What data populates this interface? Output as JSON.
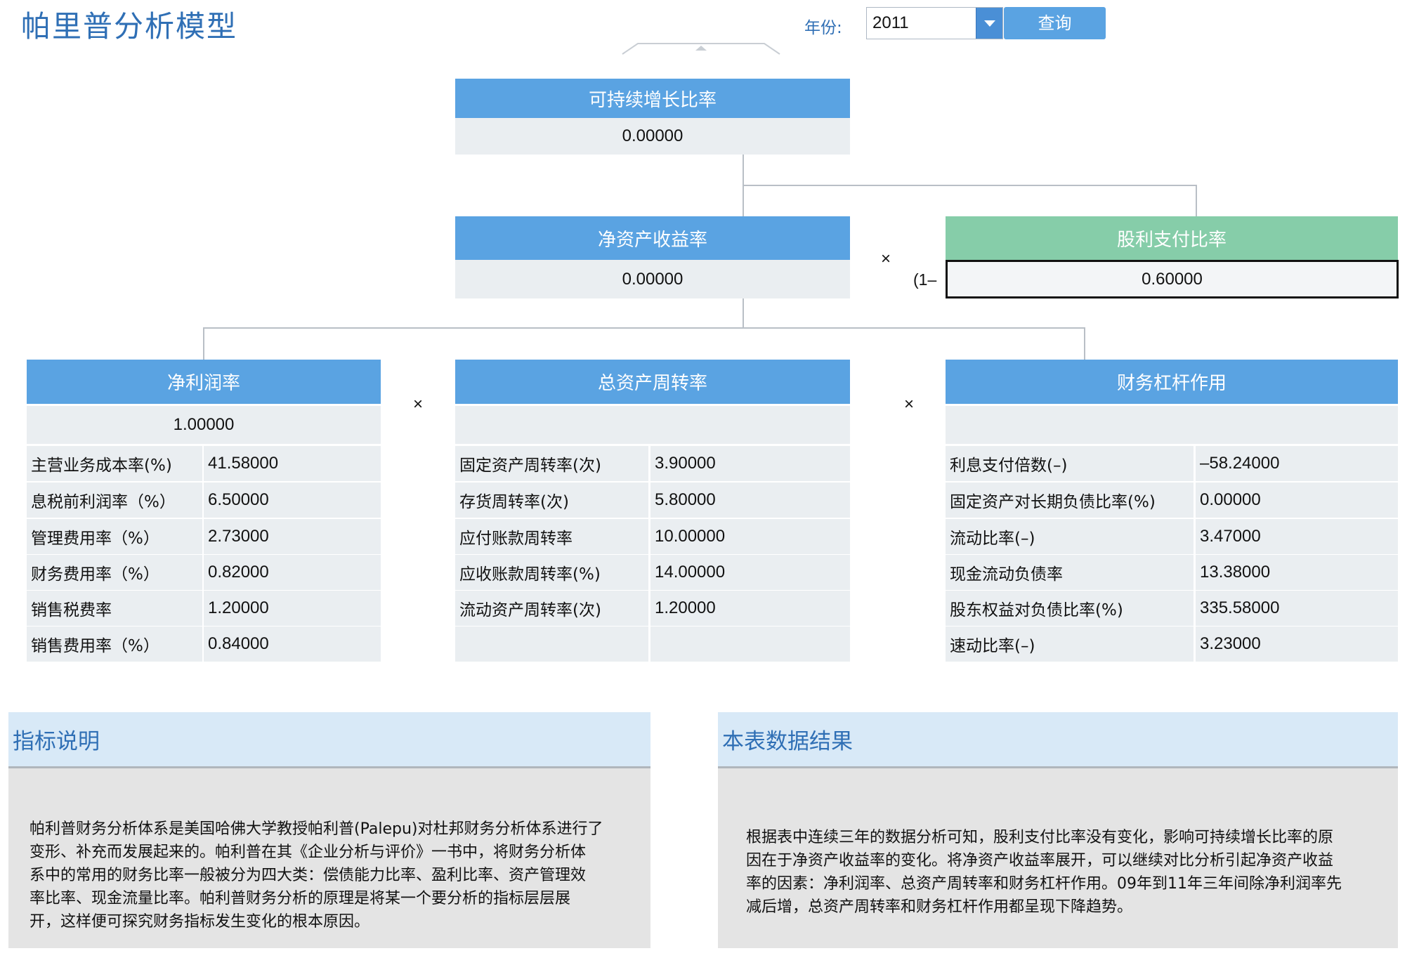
{
  "title": "帕里普分析模型",
  "filter": {
    "year_label": "年份:",
    "year_value": "2011",
    "query_label": "查询"
  },
  "sustainable_growth": {
    "label": "可持续增长比率",
    "value": "0.00000"
  },
  "roe": {
    "label": "净资产收益率",
    "value": "0.00000"
  },
  "dividend_payout": {
    "label": "股利支付比率",
    "value": "0.60000",
    "prefix": "(1–"
  },
  "operators": {
    "times": "×"
  },
  "net_margin": {
    "label": "净利润率",
    "value": "1.00000",
    "rows": [
      {
        "name": "主营业务成本率(%)",
        "value": "41.58000"
      },
      {
        "name": "息税前利润率（%）",
        "value": "6.50000"
      },
      {
        "name": "管理费用率（%）",
        "value": "2.73000"
      },
      {
        "name": "财务费用率（%）",
        "value": "0.82000"
      },
      {
        "name": "销售税费率",
        "value": "1.20000"
      },
      {
        "name": "销售费用率（%）",
        "value": "0.84000"
      }
    ]
  },
  "asset_turnover": {
    "label": "总资产周转率",
    "value": "",
    "rows": [
      {
        "name": "固定资产周转率(次)",
        "value": "3.90000"
      },
      {
        "name": "存货周转率(次)",
        "value": "5.80000"
      },
      {
        "name": "应付账款周转率",
        "value": "10.00000"
      },
      {
        "name": "应收账款周转率(%)",
        "value": "14.00000"
      },
      {
        "name": "流动资产周转率(次)",
        "value": "1.20000"
      },
      {
        "name": "",
        "value": ""
      }
    ]
  },
  "leverage": {
    "label": "财务杠杆作用",
    "value": "",
    "rows": [
      {
        "name": "利息支付倍数(–)",
        "value": "–58.24000"
      },
      {
        "name": "固定资产对长期负债比率(%)",
        "value": "0.00000"
      },
      {
        "name": "流动比率(–)",
        "value": "3.47000"
      },
      {
        "name": "现金流动负债率",
        "value": "13.38000"
      },
      {
        "name": "股东权益对负债比率(%)",
        "value": "335.58000"
      },
      {
        "name": "速动比率(–)",
        "value": "3.23000"
      }
    ]
  },
  "explanation": {
    "title": "指标说明",
    "lines": [
      "帕利普财务分析体系是美国哈佛大学教授帕利普(Palepu)对杜邦财务分析体系进行了",
      "变形、补充而发展起来的。帕利普在其《企业分析与评价》一书中，将财务分析体",
      "系中的常用的财务比率一般被分为四大类：偿债能力比率、盈利比率、资产管理效",
      "率比率、现金流量比率。帕利普财务分析的原理是将某一个要分析的指标层层展",
      "开，这样便可探究财务指标发生变化的根本原因。"
    ]
  },
  "result": {
    "title": "本表数据结果",
    "lines": [
      "根据表中连续三年的数据分析可知，股利支付比率没有变化，影响可持续增长比率的原",
      "因在于净资产收益率的变化。将净资产收益率展开，可以继续对比分析引起净资产收益",
      "率的因素：净利润率、总资产周转率和财务杠杆作用。09年到11年三年间除净利润率先",
      "减后增，总资产周转率和财务杠杆作用都呈现下降趋势。"
    ]
  }
}
